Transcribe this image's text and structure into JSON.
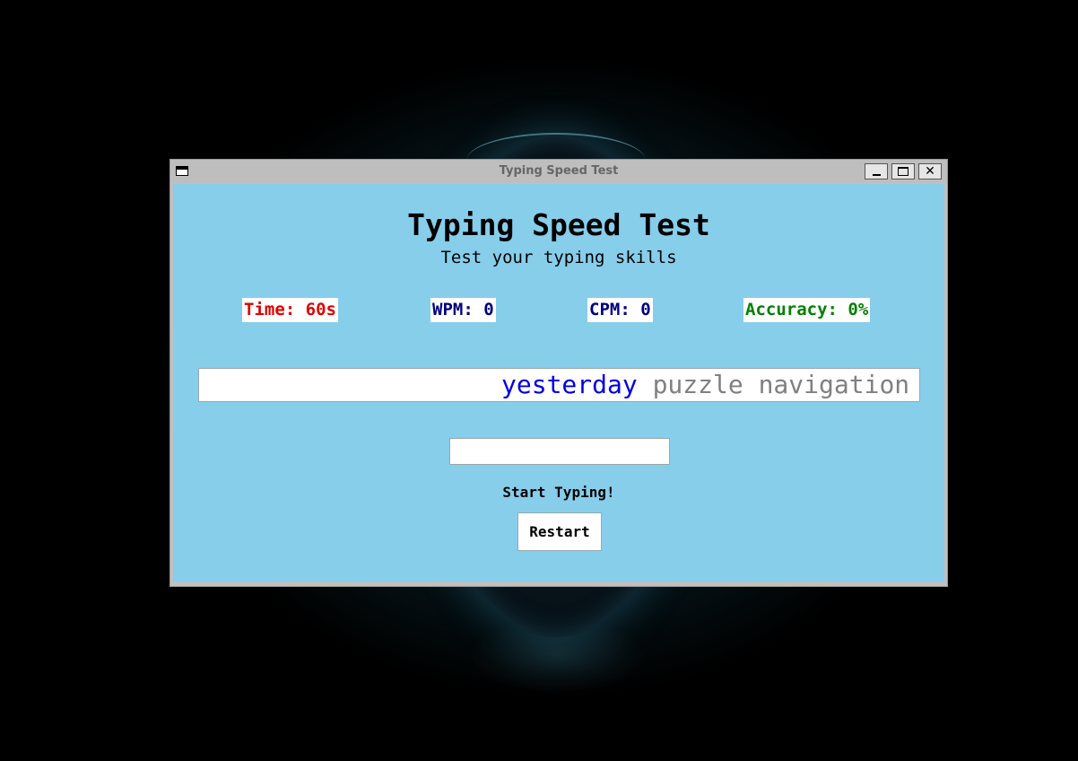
{
  "window": {
    "title": "Typing Speed Test",
    "controls": {
      "minimize": "minimize-icon",
      "maximize": "maximize-icon",
      "close": "close-icon"
    },
    "close_glyph": "✕"
  },
  "app": {
    "heading": "Typing Speed Test",
    "subheading": "Test your typing skills"
  },
  "stats": {
    "time": "Time: 60s",
    "wpm": "WPM: 0",
    "cpm": "CPM: 0",
    "accuracy": "Accuracy: 0%"
  },
  "colors": {
    "background": "#87ceeb",
    "time": "#e00000",
    "wpm_cpm": "#000080",
    "accuracy": "#008000",
    "current_word": "#0000e0",
    "upcoming_words": "#808080"
  },
  "words": {
    "current": "yesterday",
    "upcoming": " puzzle navigation s"
  },
  "input": {
    "value": "",
    "placeholder": ""
  },
  "status": "Start Typing!",
  "restart_label": "Restart"
}
